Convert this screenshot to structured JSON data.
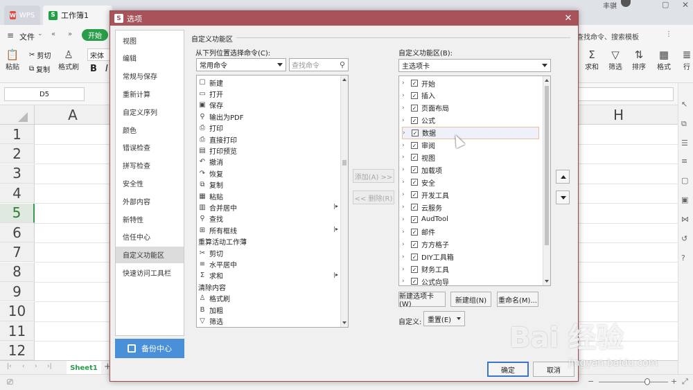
{
  "titlebar": {
    "wps_tab": "WPS",
    "workbook_tab": "工作簿1",
    "user_name": "丰骐"
  },
  "menu": {
    "file": "文件",
    "start_tab": "开始",
    "search_placeholder": "查找命令、搜索模板"
  },
  "ribbon": {
    "paste": "粘贴",
    "cut": "剪切",
    "copy": "复制",
    "format_painter": "格式刷",
    "font": "宋体",
    "bold": "B",
    "italic": "I",
    "sum": "求和",
    "filter": "筛选",
    "sort": "排序",
    "format": "格式",
    "row": "行"
  },
  "formula": {
    "cell_ref": "D5"
  },
  "sheet": {
    "columns": [
      "A",
      "H"
    ],
    "rows": [
      "1",
      "2",
      "3",
      "4",
      "5",
      "6",
      "7",
      "8",
      "9",
      "10",
      "11",
      "12"
    ],
    "selected_row": "5",
    "sheet_tab": "Sheet1"
  },
  "dialog": {
    "title": "选项",
    "nav": [
      "视图",
      "编辑",
      "常规与保存",
      "重新计算",
      "自定义序列",
      "颜色",
      "错误检查",
      "拼写检查",
      "安全性",
      "外部内容",
      "新特性",
      "信任中心",
      "自定义功能区",
      "快速访问工具栏"
    ],
    "nav_active": "自定义功能区",
    "backup_center": "备份中心",
    "group_title": "自定义功能区",
    "choose_from_label": "从下列位置选择命令(C):",
    "choose_from_value": "常用命令",
    "search_placeholder": "查找命令",
    "customize_label": "自定义功能区(B):",
    "customize_value": "主选项卡",
    "commands": [
      {
        "label": "新建",
        "icon": "☐"
      },
      {
        "label": "打开",
        "icon": "▭"
      },
      {
        "label": "保存",
        "icon": "▣"
      },
      {
        "label": "输出为PDF",
        "icon": "⚲"
      },
      {
        "label": "打印",
        "icon": "⎙"
      },
      {
        "label": "直接打印",
        "icon": "⎙"
      },
      {
        "label": "打印预览",
        "icon": "▤"
      },
      {
        "label": "撤消",
        "icon": "↶"
      },
      {
        "label": "恢复",
        "icon": "↷"
      },
      {
        "label": "复制",
        "icon": "⧉"
      },
      {
        "label": "粘贴",
        "icon": "▦"
      },
      {
        "label": "合并居中",
        "icon": "▥",
        "submenu": true
      },
      {
        "label": "查找",
        "icon": "⚲"
      },
      {
        "label": "所有框线",
        "icon": "⊞",
        "submenu": true
      },
      {
        "label": "重算活动工作薄",
        "icon": ""
      },
      {
        "label": "剪切",
        "icon": "✂"
      },
      {
        "label": "水平居中",
        "icon": "≡"
      },
      {
        "label": "求和",
        "icon": "Σ",
        "submenu": true
      },
      {
        "label": "清除内容",
        "icon": ""
      },
      {
        "label": "格式刷",
        "icon": "♙"
      },
      {
        "label": "加粗",
        "icon": "B"
      },
      {
        "label": "筛选",
        "icon": "▽"
      }
    ],
    "tabs": [
      "开始",
      "插入",
      "页面布局",
      "公式",
      "数据",
      "审阅",
      "视图",
      "加载项",
      "安全",
      "开发工具",
      "云服务",
      "AudTool",
      "邮件",
      "方方格子",
      "DIY工具箱",
      "财务工具",
      "公式向导"
    ],
    "tabs_selected": "数据",
    "add_button": "添加(A) >>",
    "remove_button": "<< 删除(R)",
    "new_tab_button": "新建选项卡(W)",
    "new_group_button": "新建组(N)",
    "rename_button": "重命名(M)...",
    "customize_text": "自定义:",
    "reset_button": "重置(E)",
    "ok_button": "确定",
    "cancel_button": "取消"
  },
  "watermark": {
    "brand": "Bai 经验",
    "url": "jingyan.baidu.com"
  }
}
